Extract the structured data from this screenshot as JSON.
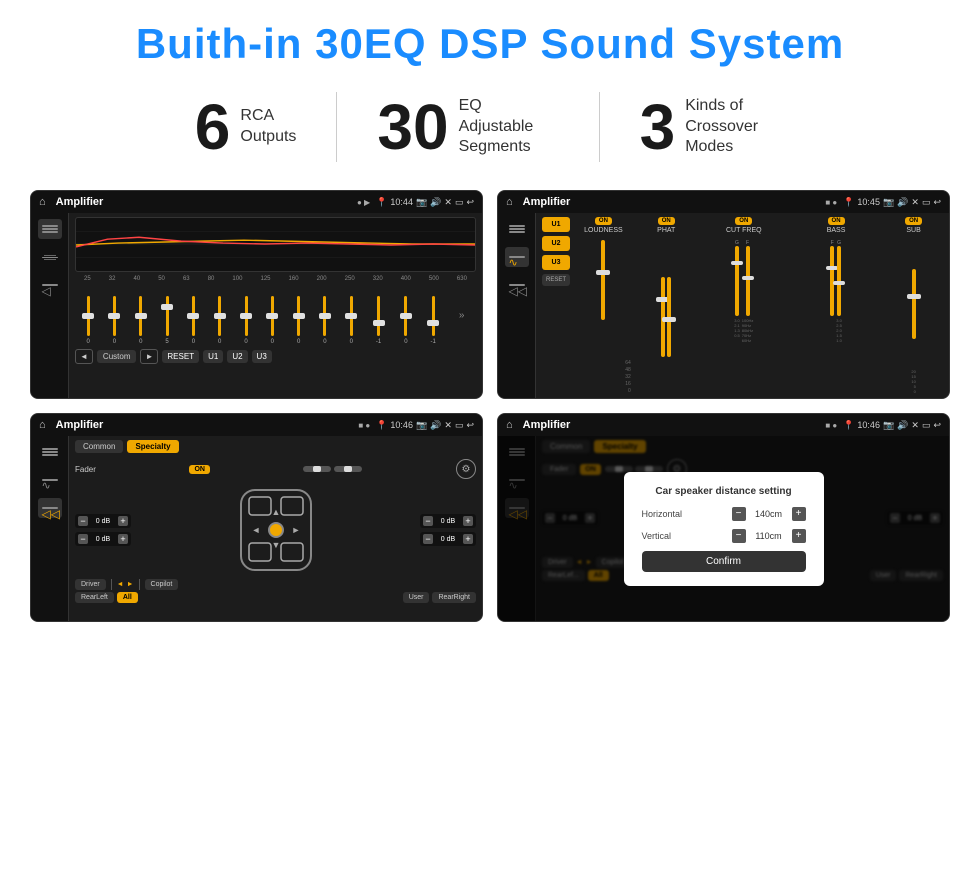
{
  "page": {
    "title": "Buith-in 30EQ DSP Sound System",
    "stats": [
      {
        "number": "6",
        "label": "RCA\nOutputs"
      },
      {
        "number": "30",
        "label": "EQ Adjustable\nSegments"
      },
      {
        "number": "3",
        "label": "Kinds of\nCrossover Modes"
      }
    ]
  },
  "screens": [
    {
      "id": "eq-screen",
      "statusBar": {
        "app": "Amplifier",
        "time": "10:44"
      },
      "type": "eq",
      "freqLabels": [
        "25",
        "32",
        "40",
        "50",
        "63",
        "80",
        "100",
        "125",
        "160",
        "200",
        "250",
        "320",
        "400",
        "500",
        "630"
      ],
      "eqValues": [
        "0",
        "0",
        "0",
        "5",
        "0",
        "0",
        "0",
        "0",
        "0",
        "0",
        "0",
        "-1",
        "0",
        "-1"
      ],
      "controls": [
        "◄",
        "Custom",
        "►",
        "RESET",
        "U1",
        "U2",
        "U3"
      ]
    },
    {
      "id": "crossover-screen",
      "statusBar": {
        "app": "Amplifier",
        "time": "10:45"
      },
      "type": "crossover",
      "presets": [
        "U1",
        "U2",
        "U3"
      ],
      "channels": [
        {
          "toggle": "ON",
          "label": "LOUDNESS"
        },
        {
          "toggle": "ON",
          "label": "PHAT"
        },
        {
          "toggle": "ON",
          "label": "CUT FREQ"
        },
        {
          "toggle": "ON",
          "label": "BASS"
        },
        {
          "toggle": "ON",
          "label": "SUB"
        }
      ],
      "resetLabel": "RESET"
    },
    {
      "id": "fader-screen",
      "statusBar": {
        "app": "Amplifier",
        "time": "10:46"
      },
      "type": "fader",
      "tabs": [
        "Common",
        "Specialty"
      ],
      "activeTab": "Specialty",
      "faderLabel": "Fader",
      "faderToggle": "ON",
      "volumes": [
        {
          "label": "0 dB",
          "side": "left"
        },
        {
          "label": "0 dB",
          "side": "left"
        },
        {
          "label": "0 dB",
          "side": "right"
        },
        {
          "label": "0 dB",
          "side": "right"
        }
      ],
      "bottomBtns": [
        "Driver",
        "RearLeft",
        "All",
        "User",
        "Copilot",
        "RearRight"
      ]
    },
    {
      "id": "distance-screen",
      "statusBar": {
        "app": "Amplifier",
        "time": "10:46"
      },
      "type": "distance",
      "tabs": [
        "Common",
        "Specialty"
      ],
      "activeTab": "Specialty",
      "modal": {
        "title": "Car speaker distance setting",
        "horizontal": {
          "label": "Horizontal",
          "value": "140cm"
        },
        "vertical": {
          "label": "Vertical",
          "value": "110cm"
        },
        "confirmLabel": "Confirm"
      },
      "volumes": [
        {
          "label": "0 dB",
          "side": "left"
        },
        {
          "label": "0 dB",
          "side": "right"
        }
      ],
      "bottomBtns": [
        "Driver",
        "RearLeft",
        "All",
        "User",
        "Copilot",
        "RearRight"
      ]
    }
  ]
}
